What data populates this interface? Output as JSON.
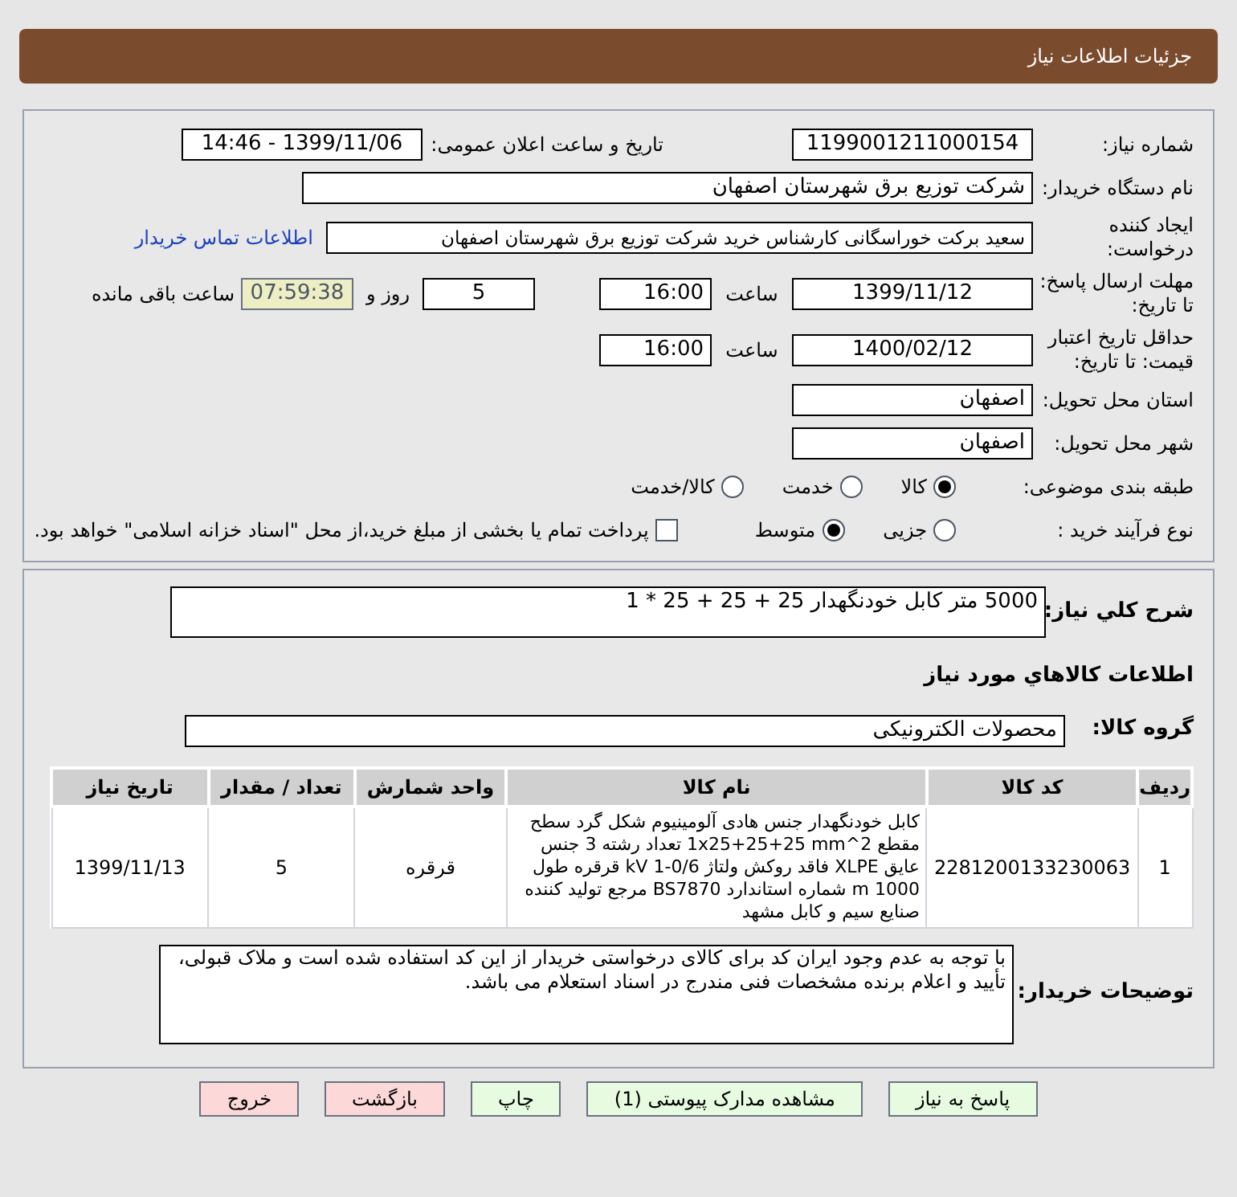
{
  "header": {
    "title": "جزئیات اطلاعات نیاز"
  },
  "need_number": {
    "label": "شماره نیاز:",
    "value": "1199001211000154"
  },
  "announce": {
    "label": "تاریخ و ساعت اعلان عمومی:",
    "value": "1399/11/06 - 14:46"
  },
  "buyer": {
    "label": "نام دستگاه خریدار:",
    "value": "شرکت توزیع برق شهرستان اصفهان"
  },
  "requester": {
    "label": "ایجاد کننده درخواست:",
    "value": "سعید برکت خوراسگانی کارشناس خرید شرکت توزیع برق شهرستان اصفهان",
    "link": "اطلاعات تماس خریدار"
  },
  "deadline": {
    "label": "مهلت ارسال پاسخ: تا تاریخ:",
    "date": "1399/11/12",
    "time_label": "ساعت",
    "time": "16:00",
    "days": "5",
    "days_label": "روز و",
    "remaining": "07:59:38",
    "remaining_label": "ساعت باقی مانده"
  },
  "validity": {
    "label": "حداقل تاریخ اعتبار قیمت: تا تاریخ:",
    "date": "1400/02/12",
    "time_label": "ساعت",
    "time": "16:00"
  },
  "province": {
    "label": "استان محل تحویل:",
    "value": "اصفهان"
  },
  "city": {
    "label": "شهر محل تحویل:",
    "value": "اصفهان"
  },
  "category": {
    "label": "طبقه بندی موضوعی:",
    "options": [
      {
        "label": "کالا",
        "selected": true
      },
      {
        "label": "خدمت",
        "selected": false
      },
      {
        "label": "کالا/خدمت",
        "selected": false
      }
    ]
  },
  "purchase_type": {
    "label": "نوع فرآیند خرید :",
    "options": [
      {
        "label": "جزیی",
        "selected": false
      },
      {
        "label": "متوسط",
        "selected": true
      }
    ],
    "treasury": {
      "label": "پرداخت تمام یا بخشی از مبلغ خرید،از محل \"اسناد خزانه اسلامی\" خواهد بود.",
      "checked": false
    }
  },
  "description": {
    "label": "شرح کلي نياز:",
    "value": "5000 متر کابل خودنگهدار 25 + 25 + 25 * 1"
  },
  "goods_heading": "اطلاعات کالاهاي مورد نياز",
  "goods_group": {
    "label": "گروه کالا:",
    "value": "محصولات الکترونیکی"
  },
  "table": {
    "columns": [
      "ردیف",
      "کد کالا",
      "نام کالا",
      "واحد شمارش",
      "تعداد / مقدار",
      "تاریخ نیاز"
    ],
    "rows": [
      [
        "1",
        "2281200133230063",
        "کابل خودنگهدار جنس هادی آلومینیوم شکل گرد سطح مقطع 2^1x25+25+25 mm تعداد رشته 3 جنس عایق XLPE فاقد روکش ولتاژ 0/6-1 kV قرقره طول 1000 m شماره استاندارد BS7870 مرجع تولید کننده صنایع سیم و کابل مشهد",
        "قرقره",
        "5",
        "1399/11/13"
      ]
    ]
  },
  "notes": {
    "label": "توضیحات خریدار:",
    "value": "با توجه به عدم وجود ایران کد برای کالای درخواستی خریدار از این کد استفاده شده است و ملاک قبولی، تأیید و اعلام برنده مشخصات فنی مندرج در اسناد استعلام می باشد."
  },
  "buttons": [
    {
      "label": "پاسخ به نیاز",
      "kind": "normal"
    },
    {
      "label": "مشاهده مدارک پیوستی (1)",
      "kind": "normal"
    },
    {
      "label": "چاپ",
      "kind": "normal"
    },
    {
      "label": "بازگشت",
      "kind": "danger"
    },
    {
      "label": "خروج",
      "kind": "danger"
    }
  ]
}
